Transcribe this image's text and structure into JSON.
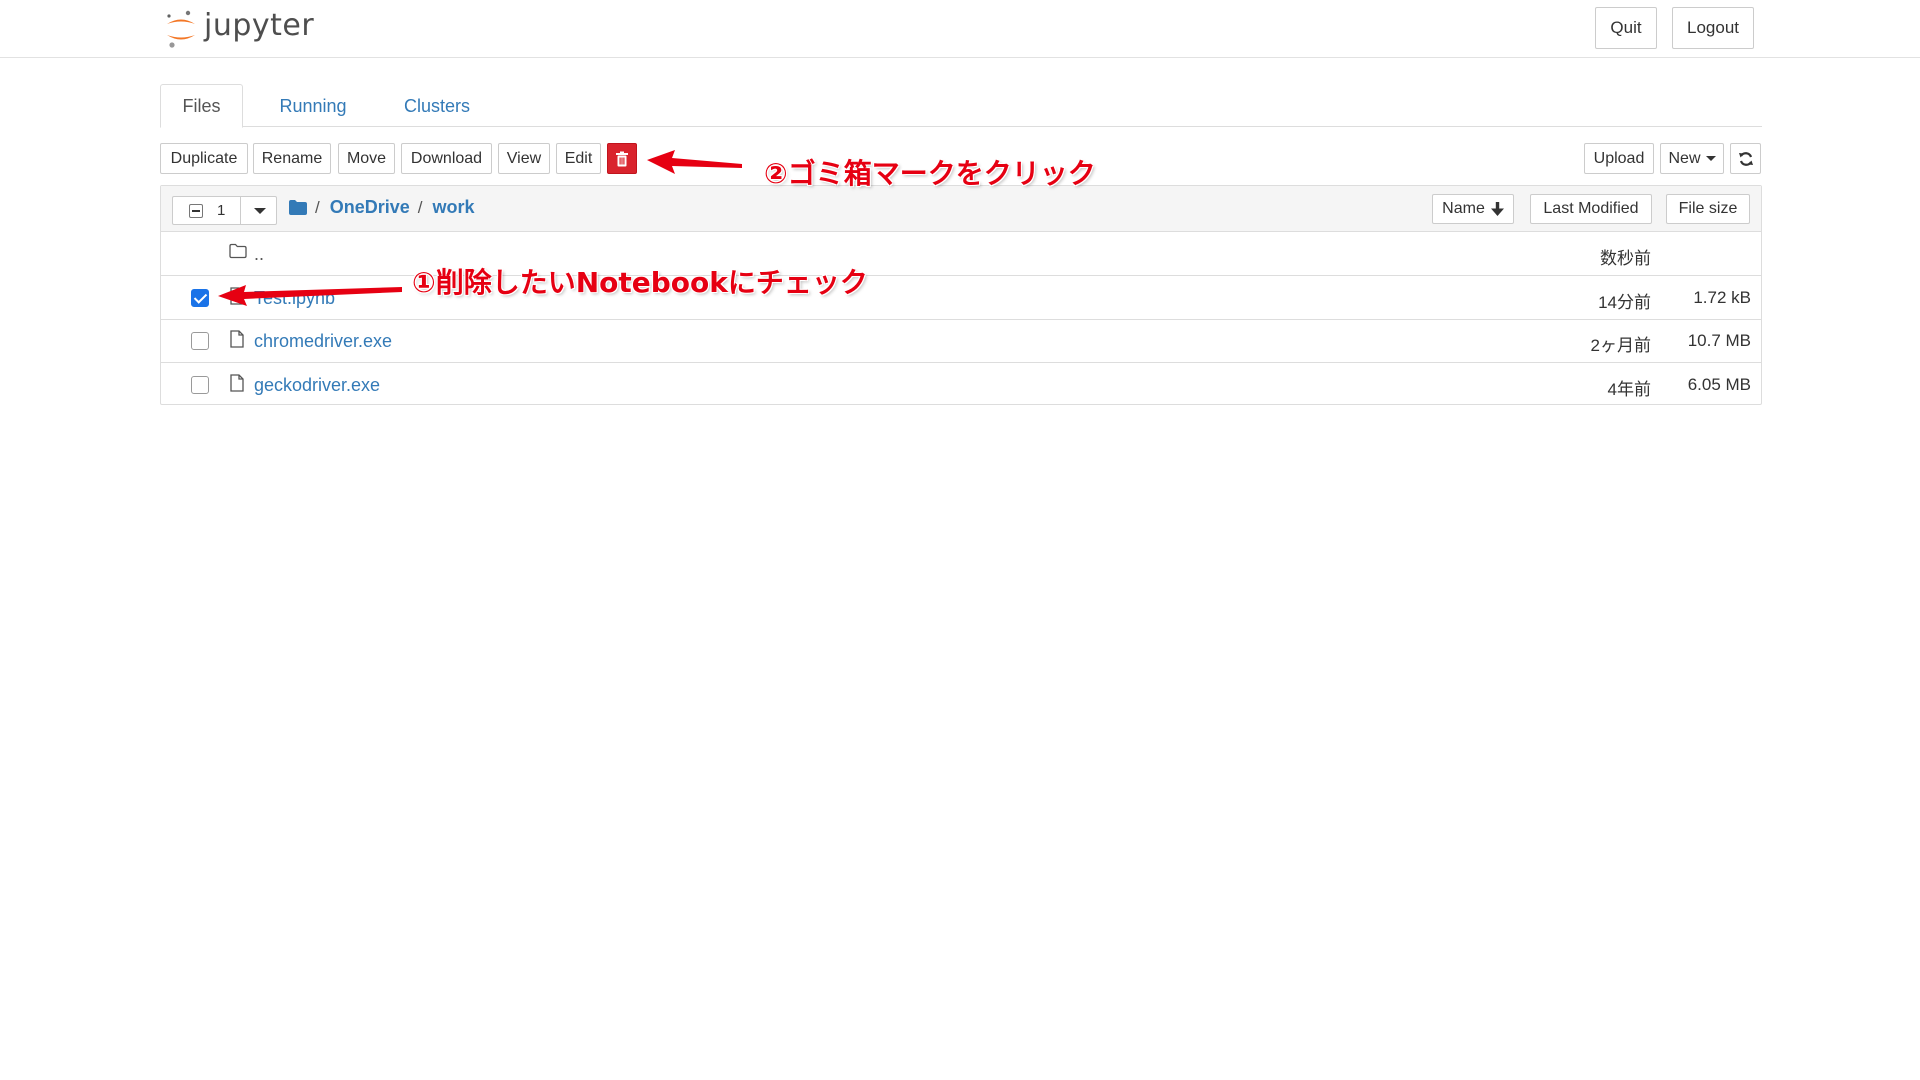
{
  "header": {
    "logo_text": "jupyter",
    "quit_label": "Quit",
    "logout_label": "Logout"
  },
  "tabs": [
    {
      "label": "Files",
      "active": true
    },
    {
      "label": "Running",
      "active": false
    },
    {
      "label": "Clusters",
      "active": false
    }
  ],
  "toolbar": {
    "duplicate_label": "Duplicate",
    "rename_label": "Rename",
    "move_label": "Move",
    "download_label": "Download",
    "view_label": "View",
    "edit_label": "Edit",
    "delete_icon": "trash-icon",
    "upload_label": "Upload",
    "new_label": "New",
    "refresh_icon": "refresh-icon"
  },
  "file_list": {
    "selected_count": "1",
    "breadcrumb": [
      {
        "label": "OneDrive"
      },
      {
        "label": "work"
      }
    ],
    "breadcrumb_sep": "/",
    "sort": {
      "name_label": "Name",
      "modified_label": "Last Modified",
      "size_label": "File size"
    },
    "rows": [
      {
        "name": "..",
        "type": "folder",
        "modified": "数秒前",
        "size": "",
        "checked": false
      },
      {
        "name": "Test.ipynb",
        "type": "notebook",
        "modified": "14分前",
        "size": "1.72 kB",
        "checked": true
      },
      {
        "name": "chromedriver.exe",
        "type": "file",
        "modified": "2ヶ月前",
        "size": "10.7 MB",
        "checked": false
      },
      {
        "name": "geckodriver.exe",
        "type": "file",
        "modified": "4年前",
        "size": "6.05 MB",
        "checked": false
      }
    ]
  },
  "annotations": {
    "step1": "①削除したいNotebookにチェック",
    "step2": "②ゴミ箱マークをクリック"
  },
  "colors": {
    "link": "#337ab7",
    "delete_button": "#d9232d",
    "annotation": "#e60012",
    "logo_orange": "#f37726"
  }
}
